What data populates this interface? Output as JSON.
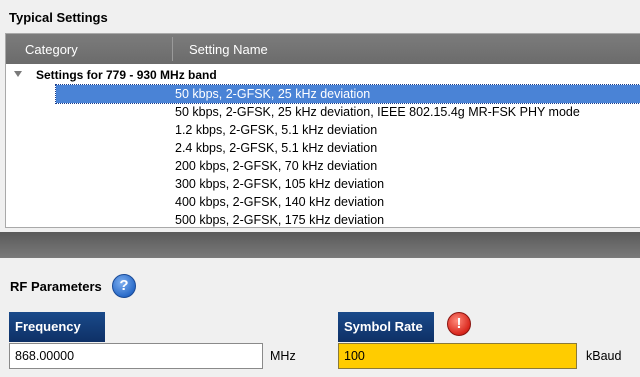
{
  "typical_settings": {
    "title": "Typical Settings",
    "columns": [
      "Category",
      "Setting Name"
    ],
    "group": {
      "label": "Settings for 779 - 930 MHz band",
      "expanded": true,
      "items": [
        {
          "label": "50 kbps, 2-GFSK, 25 kHz deviation",
          "selected": true
        },
        {
          "label": "50 kbps, 2-GFSK, 25 kHz deviation, IEEE 802.15.4g MR-FSK PHY mode",
          "selected": false
        },
        {
          "label": "1.2 kbps, 2-GFSK, 5.1 kHz deviation",
          "selected": false
        },
        {
          "label": "2.4 kbps, 2-GFSK, 5.1 kHz deviation",
          "selected": false
        },
        {
          "label": "200 kbps, 2-GFSK, 70 kHz deviation",
          "selected": false
        },
        {
          "label": "300 kbps, 2-GFSK, 105 kHz deviation",
          "selected": false
        },
        {
          "label": "400 kbps, 2-GFSK, 140 kHz deviation",
          "selected": false
        },
        {
          "label": "500 kbps, 2-GFSK, 175 kHz deviation",
          "selected": false
        }
      ]
    }
  },
  "rf_parameters": {
    "title": "RF Parameters",
    "help_icon": "question-mark-icon",
    "frequency": {
      "label": "Frequency",
      "value": "868.00000",
      "unit": "MHz"
    },
    "symbol_rate": {
      "label": "Symbol Rate",
      "value": "100",
      "unit": "kBaud",
      "warning_icon": "exclamation-icon",
      "warning_color": "#ffcc00"
    }
  },
  "colors": {
    "header_bg": "#6b6b6b",
    "selection_bg": "#4a83d6",
    "tab_bg": "#0e3066",
    "warning_field": "#ffcc00",
    "error_icon": "#d9261c",
    "help_icon": "#2a6bc9"
  }
}
